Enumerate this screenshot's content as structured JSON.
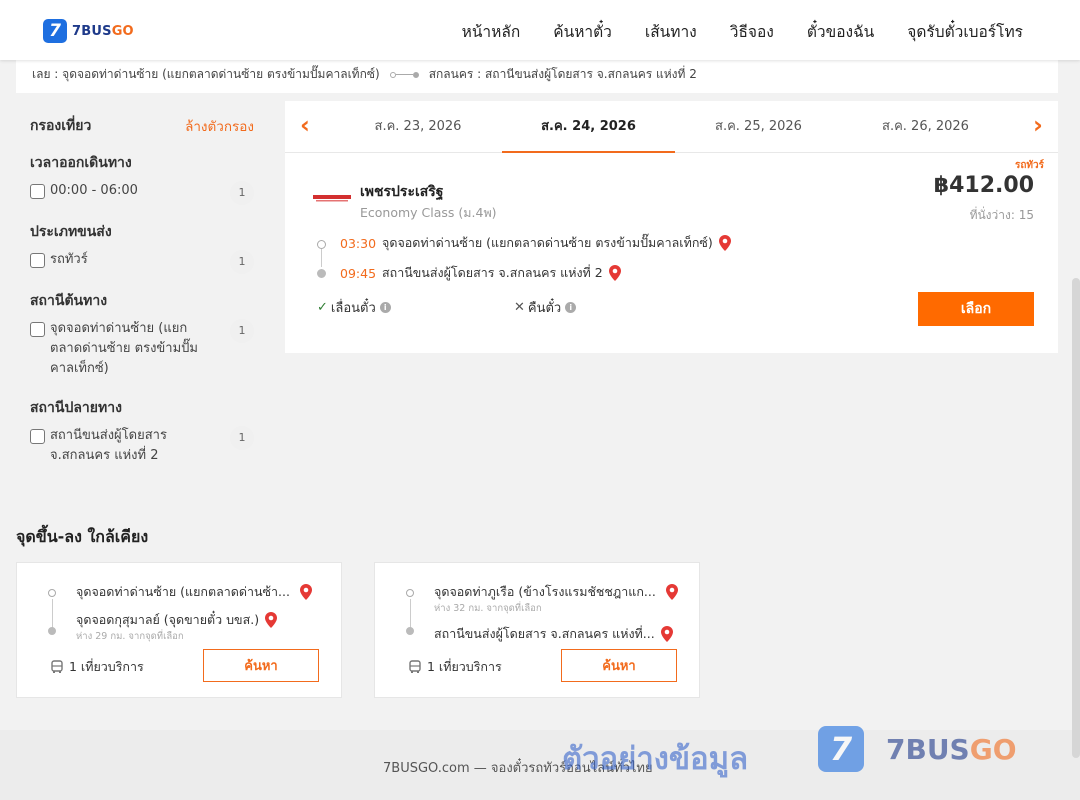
{
  "brand": {
    "logo_badge": "7",
    "logo_name": "7BUS",
    "logo_suffix": "GO"
  },
  "nav": [
    "หน้าหลัก",
    "ค้นหาตั๋ว",
    "เส้นทาง",
    "วิธีจอง",
    "ตั๋วของฉัน",
    "จุดรับตั๋วเบอร์โทร"
  ],
  "route_bar": {
    "origin": "เลย : จุดจอดท่าด่านซ้าย (แยกตลาดด่านซ้าย ตรงข้ามปั๊มคาลเท็กซ์)",
    "destination": "สกลนคร : สถานีขนส่งผู้โดยสาร จ.สกลนคร แห่งที่ 2"
  },
  "filter": {
    "title": "กรองเที่ยว",
    "clear_label": "ล้างตัวกรอง",
    "groups": [
      {
        "title": "เวลาออกเดินทาง",
        "option": "00:00 - 06:00",
        "count": "1"
      },
      {
        "title": "ประเภทขนส่ง",
        "option": "รถทัวร์",
        "count": "1"
      },
      {
        "title": "สถานีต้นทาง",
        "option": "จุดจอดท่าด่านซ้าย (แยกตลาดด่านซ้าย ตรงข้ามปั๊มคาลเท็กซ์)",
        "count": "1"
      },
      {
        "title": "สถานีปลายทาง",
        "option": "สถานีขนส่งผู้โดยสาร จ.สกลนคร แห่งที่ 2",
        "count": "1"
      }
    ]
  },
  "date_tabs": [
    "ส.ค. 23, 2026",
    "ส.ค. 24, 2026",
    "ส.ค. 25, 2026",
    "ส.ค. 26, 2026"
  ],
  "active_tab_index": 1,
  "trip": {
    "type_badge": "รถทัวร์",
    "operator": "เพชรประเสริฐ",
    "bus_class": "Economy Class (ม.4พ)",
    "price": "฿412.00",
    "seats": "ที่นั่งว่าง: 15",
    "depart_time": "03:30",
    "depart_stop": "จุดจอดท่าด่านซ้าย (แยกตลาดด่านซ้าย ตรงข้ามปั๊มคาลเท็กซ์)",
    "arrive_time": "09:45",
    "arrive_stop": "สถานีขนส่งผู้โดยสาร จ.สกลนคร แห่งที่ 2",
    "reschedule": "เลื่อนตั๋ว",
    "refund": "คืนตั๋ว",
    "select_label": "เลือก"
  },
  "nearby": {
    "title": "จุดขึ้น-ลง ใกล้เคียง",
    "cards": [
      {
        "from": "จุดจอดท่าด่านซ้าย (แยกตลาดด่านซ้า...",
        "to": "จุดจอดกุสุมาลย์ (จุดขายตั๋ว บขส.)",
        "distance": "ห่าง 29 กม. จากจุดที่เลือก",
        "trips": "1 เที่ยวบริการ",
        "button": "ค้นหา"
      },
      {
        "from": "จุดจอดท่าภูเรือ (ข้างโรงแรมชัชชฎาแก...",
        "from_distance": "ห่าง 32 กม. จากจุดที่เลือก",
        "to": "สถานีขนส่งผู้โดยสาร จ.สกลนคร แห่งที่...",
        "trips": "1 เที่ยวบริการ",
        "button": "ค้นหา"
      }
    ]
  },
  "footer": {
    "text": "7BUSGO.com — จองตั๋วรถทัวร์ออนไลน์ทั่วไทย"
  },
  "watermark": {
    "text": "ตัวอย่างข้อมูล",
    "logo_badge": "7",
    "logo_name": "7BUS",
    "logo_suffix": "GO"
  },
  "colors": {
    "accent": "#f26b1d",
    "button": "#ff6a00",
    "brand_blue": "#1e6fe0"
  }
}
